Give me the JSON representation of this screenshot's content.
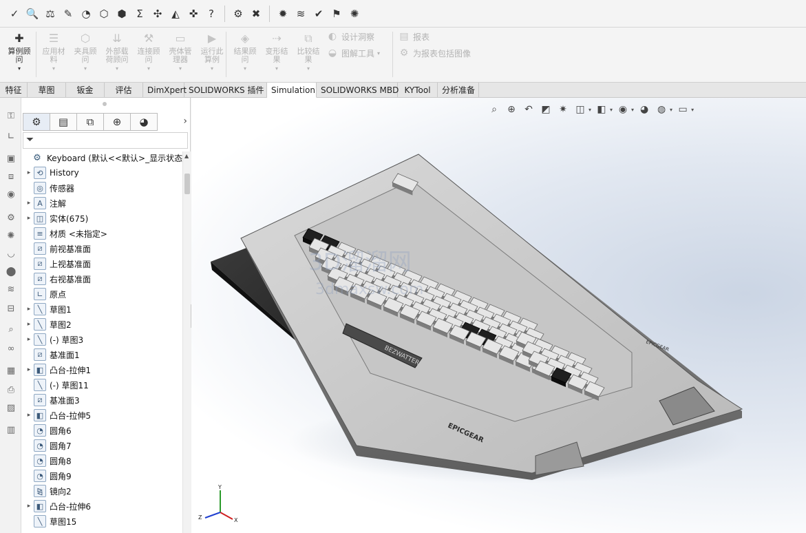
{
  "top_toolbar": {
    "icons": [
      {
        "name": "spell-check-icon",
        "glyph": "✓"
      },
      {
        "name": "find-icon",
        "glyph": "🔍"
      },
      {
        "name": "balance-icon",
        "glyph": "⚖"
      },
      {
        "name": "edit-sheet-icon",
        "glyph": "✎"
      },
      {
        "name": "gauge-icon",
        "glyph": "◔"
      },
      {
        "name": "cube-check-icon",
        "glyph": "⬡"
      },
      {
        "name": "shield-check-icon",
        "glyph": "⬢"
      },
      {
        "name": "sum-icon",
        "glyph": "Σ"
      },
      {
        "name": "cross-arrows-icon",
        "glyph": "✣"
      },
      {
        "name": "mirror-icon",
        "glyph": "◭"
      },
      {
        "name": "split-icon",
        "glyph": "✜"
      },
      {
        "name": "question-doc-icon",
        "glyph": "?"
      },
      {
        "name": "settings-check-icon",
        "glyph": "⚙"
      },
      {
        "name": "export-excel-icon",
        "glyph": "✖"
      },
      {
        "name": "analysis-icon",
        "glyph": "✹"
      },
      {
        "name": "wave-icon",
        "glyph": "≋"
      },
      {
        "name": "check-circle-icon",
        "glyph": "✔"
      },
      {
        "name": "flag-icon",
        "glyph": "⚑"
      },
      {
        "name": "globe-icon",
        "glyph": "✺"
      }
    ]
  },
  "command_manager": {
    "buttons": [
      {
        "label": "算例顾问",
        "icon": "study-advisor-icon",
        "glyph": "✚",
        "disabled": false
      },
      {
        "label": "应用材料",
        "icon": "apply-material-icon",
        "glyph": "☰",
        "disabled": true
      },
      {
        "label": "夹具顾问",
        "icon": "fixture-advisor-icon",
        "glyph": "⬡",
        "disabled": true
      },
      {
        "label": "外部载荷顾问",
        "icon": "load-advisor-icon",
        "glyph": "⇊",
        "disabled": true
      },
      {
        "label": "连接顾问",
        "icon": "connection-advisor-icon",
        "glyph": "⚒",
        "disabled": true
      },
      {
        "label": "壳体管理器",
        "icon": "shell-manager-icon",
        "glyph": "▭",
        "disabled": true
      },
      {
        "label": "运行此算例",
        "icon": "run-study-icon",
        "glyph": "▶",
        "disabled": true
      },
      {
        "label": "结果顾问",
        "icon": "results-advisor-icon",
        "glyph": "◈",
        "disabled": true
      },
      {
        "label": "变形结果",
        "icon": "deformed-result-icon",
        "glyph": "⇢",
        "disabled": true
      },
      {
        "label": "比较结果",
        "icon": "compare-results-icon",
        "glyph": "⧉",
        "disabled": true
      }
    ],
    "row_items": [
      {
        "label": "设计洞察",
        "icon": "design-insight-icon",
        "glyph": "◐"
      },
      {
        "label": "图解工具",
        "icon": "plot-tools-icon",
        "glyph": "◒"
      },
      {
        "label": "报表",
        "icon": "report-icon",
        "glyph": "▤"
      },
      {
        "label": "为报表包括图像",
        "icon": "include-image-icon",
        "glyph": "⚙"
      }
    ]
  },
  "tabs": [
    {
      "label": "特征",
      "active": false
    },
    {
      "label": "草图",
      "active": false
    },
    {
      "label": "钣金",
      "active": false
    },
    {
      "label": "评估",
      "active": false
    },
    {
      "label": "DimXpert",
      "active": false
    },
    {
      "label": "SOLIDWORKS 插件",
      "active": false
    },
    {
      "label": "Simulation",
      "active": true
    },
    {
      "label": "SOLIDWORKS MBD",
      "active": false
    },
    {
      "label": "KYTool",
      "active": false
    },
    {
      "label": "分析准备",
      "active": false
    }
  ],
  "left_bar_icons": [
    {
      "name": "key-icon",
      "glyph": "⚿"
    },
    {
      "name": "axis-icon",
      "glyph": "∟"
    },
    {
      "name": "monitor-icon",
      "glyph": "▣"
    },
    {
      "name": "assembly-icon",
      "glyph": "⧈"
    },
    {
      "name": "sphere-icon",
      "glyph": "◉"
    },
    {
      "name": "gear-icon",
      "glyph": "⚙"
    },
    {
      "name": "cog-sphere-icon",
      "glyph": "✺"
    },
    {
      "name": "bowl-icon",
      "glyph": "◡"
    },
    {
      "name": "pin-icon",
      "glyph": "⬤"
    },
    {
      "name": "spring-icon",
      "glyph": "≋"
    },
    {
      "name": "cylinder-icon",
      "glyph": "⊟"
    },
    {
      "name": "search-icon",
      "glyph": "⌕"
    },
    {
      "name": "binoculars-icon",
      "glyph": "∞"
    },
    {
      "name": "excel-icon",
      "glyph": "▦"
    },
    {
      "name": "printer-icon",
      "glyph": "⎙"
    },
    {
      "name": "image-icon",
      "glyph": "▨"
    },
    {
      "name": "report-doc-icon",
      "glyph": "▥"
    }
  ],
  "feature_manager": {
    "tabs": [
      {
        "name": "feature-tree-tab",
        "glyph": "⚙"
      },
      {
        "name": "property-manager-tab",
        "glyph": "▤"
      },
      {
        "name": "configuration-manager-tab",
        "glyph": "⧉"
      },
      {
        "name": "dimxpert-manager-tab",
        "glyph": "⊕"
      },
      {
        "name": "display-manager-tab",
        "glyph": "◕"
      }
    ],
    "expand_glyph": "›",
    "filter_glyph": "⏷",
    "tree": [
      {
        "label": "Keyboard  (默认<<默认>_显示状态 1",
        "caret": "",
        "icon": "part-icon",
        "glyph": "⚙",
        "indent": 0
      },
      {
        "label": "History",
        "caret": "▸",
        "icon": "history-icon",
        "glyph": "⟲",
        "indent": 1
      },
      {
        "label": "传感器",
        "caret": "",
        "icon": "sensor-icon",
        "glyph": "◎",
        "indent": 1
      },
      {
        "label": "注解",
        "caret": "▸",
        "icon": "annotation-icon",
        "glyph": "A",
        "indent": 1
      },
      {
        "label": "实体(675)",
        "caret": "▸",
        "icon": "solid-bodies-icon",
        "glyph": "◫",
        "indent": 1
      },
      {
        "label": "材质 <未指定>",
        "caret": "",
        "icon": "material-icon",
        "glyph": "≡",
        "indent": 1
      },
      {
        "label": "前视基准面",
        "caret": "",
        "icon": "plane-icon",
        "glyph": "⧄",
        "indent": 1
      },
      {
        "label": "上视基准面",
        "caret": "",
        "icon": "plane-icon",
        "glyph": "⧄",
        "indent": 1
      },
      {
        "label": "右视基准面",
        "caret": "",
        "icon": "plane-icon",
        "glyph": "⧄",
        "indent": 1
      },
      {
        "label": "原点",
        "caret": "",
        "icon": "origin-icon",
        "glyph": "∟",
        "indent": 1
      },
      {
        "label": "草图1",
        "caret": "▸",
        "icon": "sketch-icon",
        "glyph": "╲",
        "indent": 1
      },
      {
        "label": "草图2",
        "caret": "▸",
        "icon": "sketch-icon",
        "glyph": "╲",
        "indent": 1
      },
      {
        "label": "(-) 草图3",
        "caret": "▸",
        "icon": "sketch-icon",
        "glyph": "╲",
        "indent": 1
      },
      {
        "label": "基准面1",
        "caret": "",
        "icon": "plane-icon",
        "glyph": "⧄",
        "indent": 1
      },
      {
        "label": "凸台-拉伸1",
        "caret": "▸",
        "icon": "extrude-icon",
        "glyph": "◧",
        "indent": 1
      },
      {
        "label": "(-) 草图11",
        "caret": "",
        "icon": "sketch-icon",
        "glyph": "╲",
        "indent": 1
      },
      {
        "label": "基准面3",
        "caret": "",
        "icon": "plane-icon",
        "glyph": "⧄",
        "indent": 1
      },
      {
        "label": "凸台-拉伸5",
        "caret": "▸",
        "icon": "extrude-icon",
        "glyph": "◧",
        "indent": 1
      },
      {
        "label": "圆角6",
        "caret": "",
        "icon": "fillet-icon",
        "glyph": "◔",
        "indent": 1
      },
      {
        "label": "圆角7",
        "caret": "",
        "icon": "fillet-icon",
        "glyph": "◔",
        "indent": 1
      },
      {
        "label": "圆角8",
        "caret": "",
        "icon": "fillet-icon",
        "glyph": "◔",
        "indent": 1
      },
      {
        "label": "圆角9",
        "caret": "",
        "icon": "fillet-icon",
        "glyph": "◔",
        "indent": 1
      },
      {
        "label": "镜向2",
        "caret": "",
        "icon": "mirror-icon",
        "glyph": "⧎",
        "indent": 1
      },
      {
        "label": "凸台-拉伸6",
        "caret": "▸",
        "icon": "extrude-icon",
        "glyph": "◧",
        "indent": 1
      },
      {
        "label": "草图15",
        "caret": "",
        "icon": "sketch-icon",
        "glyph": "╲",
        "indent": 1
      }
    ]
  },
  "heads_up_toolbar": [
    {
      "name": "zoom-to-fit-icon",
      "glyph": "⌕",
      "caret": false
    },
    {
      "name": "zoom-to-area-icon",
      "glyph": "⊕",
      "caret": false
    },
    {
      "name": "previous-view-icon",
      "glyph": "↶",
      "caret": false
    },
    {
      "name": "section-view-icon",
      "glyph": "◩",
      "caret": false
    },
    {
      "name": "dynamic-annotation-icon",
      "glyph": "✷",
      "caret": false
    },
    {
      "name": "view-orientation-icon",
      "glyph": "◫",
      "caret": true
    },
    {
      "name": "display-style-icon",
      "glyph": "◧",
      "caret": true
    },
    {
      "name": "hide-show-icon",
      "glyph": "◉",
      "caret": true
    },
    {
      "name": "appearance-icon",
      "glyph": "◕",
      "caret": false
    },
    {
      "name": "scene-icon",
      "glyph": "◍",
      "caret": true
    },
    {
      "name": "view-settings-icon",
      "glyph": "▭",
      "caret": true
    }
  ],
  "model": {
    "logo_text": "BEZWATTER",
    "badge_text": "EPICGEAR",
    "brand_text": "EPICGEAR",
    "watermark_text": "3dmaxsw.com",
    "watermark_cn": "3D溜溜网"
  },
  "triad": {
    "x": "X",
    "y": "Y",
    "z": "Z"
  }
}
